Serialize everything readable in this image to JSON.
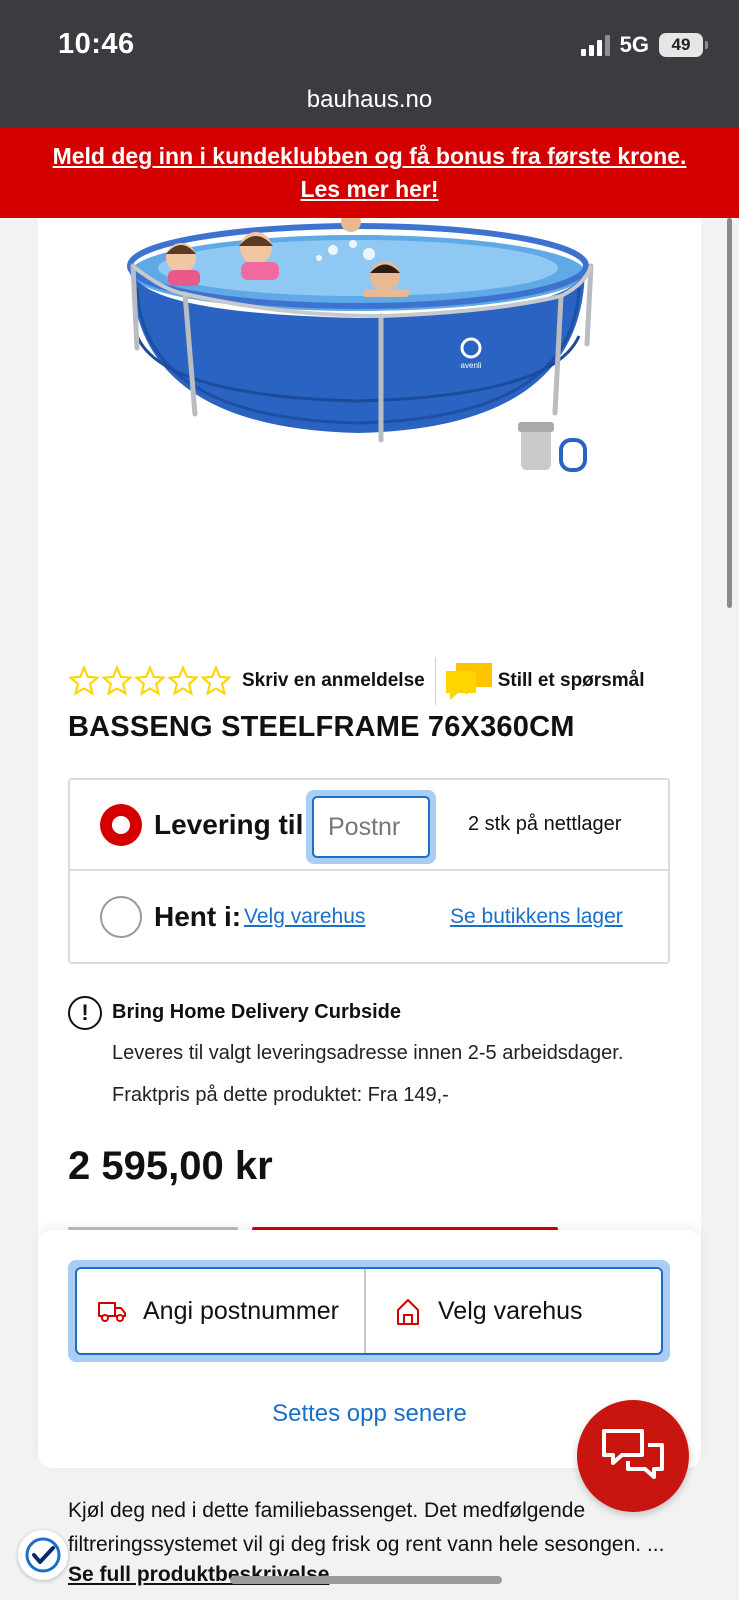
{
  "status_bar": {
    "time": "10:46",
    "network": "5G",
    "battery": "49"
  },
  "browser": {
    "url": "bauhaus.no"
  },
  "promo": {
    "line1": "Meld deg inn i kundeklubben og få bonus fra første krone.",
    "line2": "Les mer her!"
  },
  "product_image": {
    "brand_mark": "avenli"
  },
  "rating": {
    "stars_filled": 0,
    "stars_total": 5,
    "review_link": "Skriv en anmeldelse",
    "question_link": "Still et spørsmål"
  },
  "product": {
    "title": "BASSENG STEELFRAME 76X360CM",
    "price": "2 595,00 kr"
  },
  "delivery": {
    "deliver_label": "Levering til:",
    "postnr_placeholder": "Postnr",
    "stock_text": "2 stk på nettlager",
    "pickup_label": "Hent i:",
    "choose_store_link": "Velg varehus",
    "store_stock_link": "Se butikkens lager"
  },
  "info": {
    "title": "Bring Home Delivery Curbside",
    "line1": "Leveres til valgt leveringsadresse innen 2-5 arbeidsdager.",
    "line2": "Fraktpris på dette produktet: Fra 149,-"
  },
  "sheet": {
    "postcode_button": "Angi postnummer",
    "store_button": "Velg varehus",
    "later_link": "Settes opp senere"
  },
  "description": {
    "text": "Kjøl deg ned i dette familiebassenget. Det medfølgende filtreringssystemet vil gi deg frisk og rent vann hele sesongen. ...",
    "link": "Se full produktbeskrivelse"
  },
  "colors": {
    "brand_red": "#d40000",
    "link_blue": "#1a6fc9",
    "star_yellow": "#ffd500"
  }
}
